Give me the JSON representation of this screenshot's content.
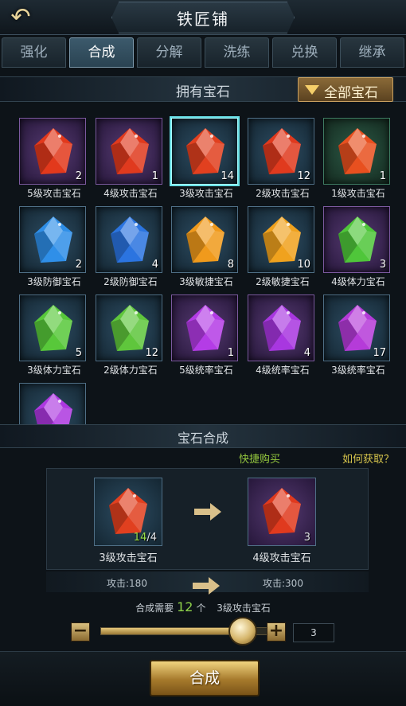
{
  "header": {
    "title": "铁匠铺",
    "back_icon": "back-arrow-icon"
  },
  "tabs": [
    {
      "label": "强化",
      "active": false
    },
    {
      "label": "合成",
      "active": true
    },
    {
      "label": "分解",
      "active": false
    },
    {
      "label": "洗练",
      "active": false
    },
    {
      "label": "兑换",
      "active": false
    },
    {
      "label": "继承",
      "active": false
    }
  ],
  "inventory": {
    "title": "拥有宝石",
    "filter_label": "全部宝石",
    "gems": [
      {
        "name": "5级攻击宝石",
        "count": "2",
        "color": "#e2391c",
        "slot": "purple"
      },
      {
        "name": "4级攻击宝石",
        "count": "1",
        "color": "#e03a1e",
        "slot": "purple"
      },
      {
        "name": "3级攻击宝石",
        "count": "14",
        "color": "#e1401f",
        "slot": "blue",
        "selected": true
      },
      {
        "name": "2级攻击宝石",
        "count": "12",
        "color": "#e03a1e",
        "slot": "blue"
      },
      {
        "name": "1级攻击宝石",
        "count": "1",
        "color": "#e8501f",
        "slot": "green"
      },
      {
        "name": "3级防御宝石",
        "count": "2",
        "color": "#2f8fe8",
        "slot": "blue"
      },
      {
        "name": "2级防御宝石",
        "count": "4",
        "color": "#2b74e0",
        "slot": "blue"
      },
      {
        "name": "3级敏捷宝石",
        "count": "8",
        "color": "#f09a1c",
        "slot": "blue"
      },
      {
        "name": "2级敏捷宝石",
        "count": "10",
        "color": "#f0a21e",
        "slot": "blue"
      },
      {
        "name": "4级体力宝石",
        "count": "3",
        "color": "#4fc63a",
        "slot": "purple"
      },
      {
        "name": "3级体力宝石",
        "count": "5",
        "color": "#58c83a",
        "slot": "blue"
      },
      {
        "name": "2级体力宝石",
        "count": "12",
        "color": "#5fc63c",
        "slot": "blue"
      },
      {
        "name": "5级统率宝石",
        "count": "1",
        "color": "#b43ce6",
        "slot": "purple"
      },
      {
        "name": "4级统率宝石",
        "count": "4",
        "color": "#a837e0",
        "slot": "purple"
      },
      {
        "name": "3级统率宝石",
        "count": "17",
        "color": "#b53bd9",
        "slot": "blue"
      },
      {
        "name": "",
        "count": "",
        "color": "#ad38e0",
        "slot": "blue"
      }
    ]
  },
  "compose": {
    "title": "宝石合成",
    "quick_buy": "快捷购买",
    "how_to_get": "如何获取？",
    "source": {
      "name": "3级攻击宝石",
      "have": "14",
      "need": "/4",
      "color": "#e1401f"
    },
    "target": {
      "name": "4级攻击宝石",
      "count": "3",
      "color": "#e03a1e"
    },
    "source_stat": "攻击:180",
    "target_stat": "攻击:300",
    "need_prefix": "合成需要",
    "need_number": "12",
    "need_unit": "个",
    "need_item": "3级攻击宝石",
    "slider_fraction": 0.85,
    "quantity": "3",
    "button_label": "合成"
  }
}
